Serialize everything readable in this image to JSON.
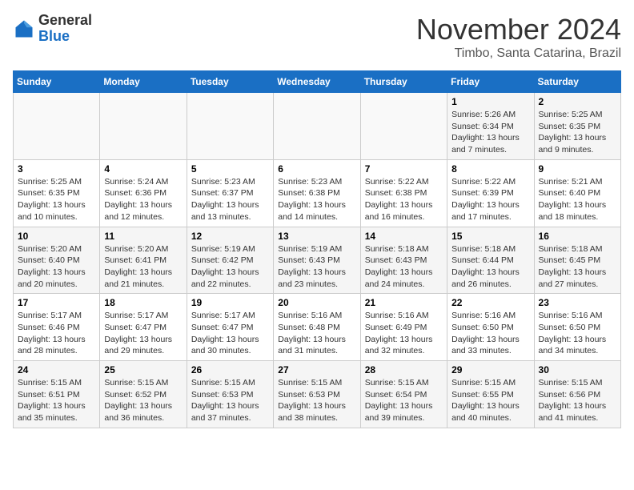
{
  "logo": {
    "general": "General",
    "blue": "Blue"
  },
  "title": "November 2024",
  "location": "Timbo, Santa Catarina, Brazil",
  "weekdays": [
    "Sunday",
    "Monday",
    "Tuesday",
    "Wednesday",
    "Thursday",
    "Friday",
    "Saturday"
  ],
  "weeks": [
    [
      {
        "day": "",
        "info": ""
      },
      {
        "day": "",
        "info": ""
      },
      {
        "day": "",
        "info": ""
      },
      {
        "day": "",
        "info": ""
      },
      {
        "day": "",
        "info": ""
      },
      {
        "day": "1",
        "info": "Sunrise: 5:26 AM\nSunset: 6:34 PM\nDaylight: 13 hours and 7 minutes."
      },
      {
        "day": "2",
        "info": "Sunrise: 5:25 AM\nSunset: 6:35 PM\nDaylight: 13 hours and 9 minutes."
      }
    ],
    [
      {
        "day": "3",
        "info": "Sunrise: 5:25 AM\nSunset: 6:35 PM\nDaylight: 13 hours and 10 minutes."
      },
      {
        "day": "4",
        "info": "Sunrise: 5:24 AM\nSunset: 6:36 PM\nDaylight: 13 hours and 12 minutes."
      },
      {
        "day": "5",
        "info": "Sunrise: 5:23 AM\nSunset: 6:37 PM\nDaylight: 13 hours and 13 minutes."
      },
      {
        "day": "6",
        "info": "Sunrise: 5:23 AM\nSunset: 6:38 PM\nDaylight: 13 hours and 14 minutes."
      },
      {
        "day": "7",
        "info": "Sunrise: 5:22 AM\nSunset: 6:38 PM\nDaylight: 13 hours and 16 minutes."
      },
      {
        "day": "8",
        "info": "Sunrise: 5:22 AM\nSunset: 6:39 PM\nDaylight: 13 hours and 17 minutes."
      },
      {
        "day": "9",
        "info": "Sunrise: 5:21 AM\nSunset: 6:40 PM\nDaylight: 13 hours and 18 minutes."
      }
    ],
    [
      {
        "day": "10",
        "info": "Sunrise: 5:20 AM\nSunset: 6:40 PM\nDaylight: 13 hours and 20 minutes."
      },
      {
        "day": "11",
        "info": "Sunrise: 5:20 AM\nSunset: 6:41 PM\nDaylight: 13 hours and 21 minutes."
      },
      {
        "day": "12",
        "info": "Sunrise: 5:19 AM\nSunset: 6:42 PM\nDaylight: 13 hours and 22 minutes."
      },
      {
        "day": "13",
        "info": "Sunrise: 5:19 AM\nSunset: 6:43 PM\nDaylight: 13 hours and 23 minutes."
      },
      {
        "day": "14",
        "info": "Sunrise: 5:18 AM\nSunset: 6:43 PM\nDaylight: 13 hours and 24 minutes."
      },
      {
        "day": "15",
        "info": "Sunrise: 5:18 AM\nSunset: 6:44 PM\nDaylight: 13 hours and 26 minutes."
      },
      {
        "day": "16",
        "info": "Sunrise: 5:18 AM\nSunset: 6:45 PM\nDaylight: 13 hours and 27 minutes."
      }
    ],
    [
      {
        "day": "17",
        "info": "Sunrise: 5:17 AM\nSunset: 6:46 PM\nDaylight: 13 hours and 28 minutes."
      },
      {
        "day": "18",
        "info": "Sunrise: 5:17 AM\nSunset: 6:47 PM\nDaylight: 13 hours and 29 minutes."
      },
      {
        "day": "19",
        "info": "Sunrise: 5:17 AM\nSunset: 6:47 PM\nDaylight: 13 hours and 30 minutes."
      },
      {
        "day": "20",
        "info": "Sunrise: 5:16 AM\nSunset: 6:48 PM\nDaylight: 13 hours and 31 minutes."
      },
      {
        "day": "21",
        "info": "Sunrise: 5:16 AM\nSunset: 6:49 PM\nDaylight: 13 hours and 32 minutes."
      },
      {
        "day": "22",
        "info": "Sunrise: 5:16 AM\nSunset: 6:50 PM\nDaylight: 13 hours and 33 minutes."
      },
      {
        "day": "23",
        "info": "Sunrise: 5:16 AM\nSunset: 6:50 PM\nDaylight: 13 hours and 34 minutes."
      }
    ],
    [
      {
        "day": "24",
        "info": "Sunrise: 5:15 AM\nSunset: 6:51 PM\nDaylight: 13 hours and 35 minutes."
      },
      {
        "day": "25",
        "info": "Sunrise: 5:15 AM\nSunset: 6:52 PM\nDaylight: 13 hours and 36 minutes."
      },
      {
        "day": "26",
        "info": "Sunrise: 5:15 AM\nSunset: 6:53 PM\nDaylight: 13 hours and 37 minutes."
      },
      {
        "day": "27",
        "info": "Sunrise: 5:15 AM\nSunset: 6:53 PM\nDaylight: 13 hours and 38 minutes."
      },
      {
        "day": "28",
        "info": "Sunrise: 5:15 AM\nSunset: 6:54 PM\nDaylight: 13 hours and 39 minutes."
      },
      {
        "day": "29",
        "info": "Sunrise: 5:15 AM\nSunset: 6:55 PM\nDaylight: 13 hours and 40 minutes."
      },
      {
        "day": "30",
        "info": "Sunrise: 5:15 AM\nSunset: 6:56 PM\nDaylight: 13 hours and 41 minutes."
      }
    ]
  ]
}
